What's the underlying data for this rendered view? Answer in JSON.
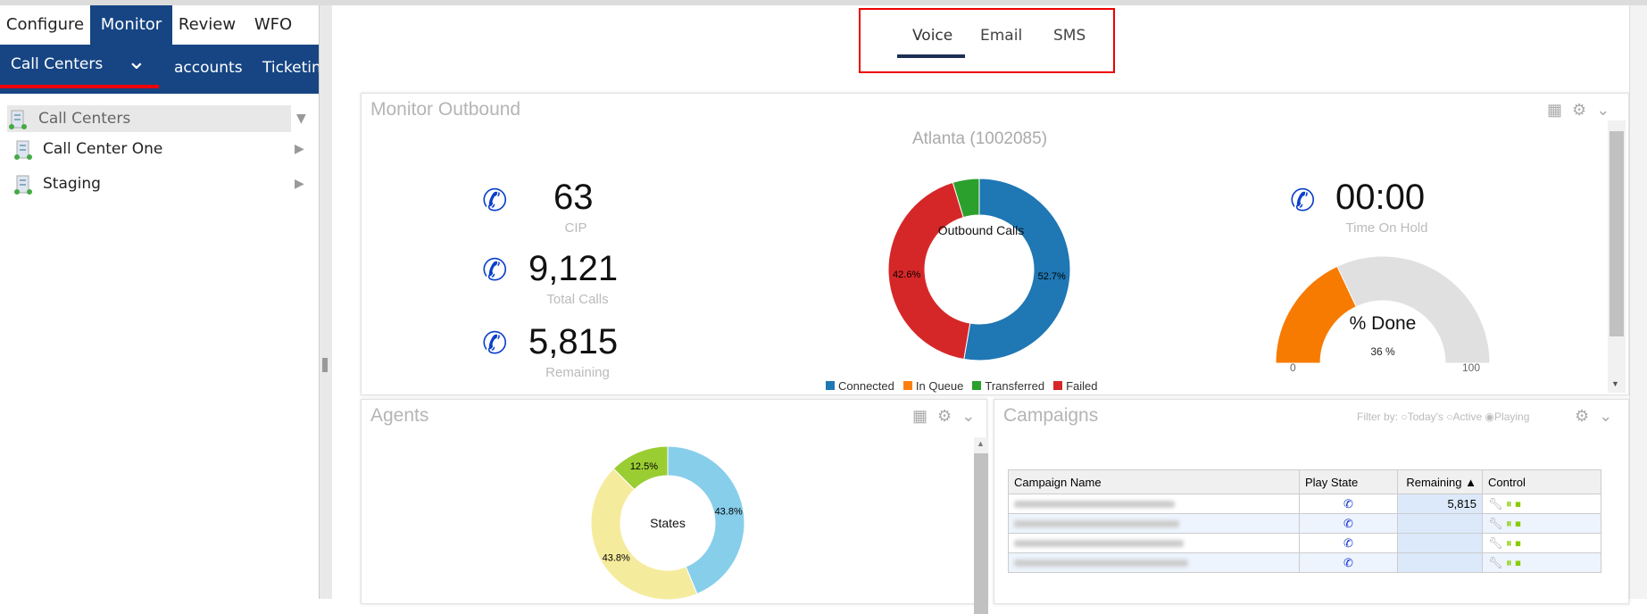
{
  "top_tabs": [
    {
      "label": "Configure"
    },
    {
      "label": "Monitor",
      "active": true
    },
    {
      "label": "Review"
    },
    {
      "label": "WFO"
    }
  ],
  "subnav": {
    "items": [
      {
        "label": "Call Centers",
        "active": true
      },
      {
        "label": "accounts"
      },
      {
        "label": "Ticketing"
      }
    ]
  },
  "tree": {
    "root": "Call Centers",
    "items": [
      {
        "label": "Call Center One"
      },
      {
        "label": "Staging"
      }
    ]
  },
  "channel_tabs": [
    {
      "label": "Voice",
      "active": true
    },
    {
      "label": "Email"
    },
    {
      "label": "SMS"
    }
  ],
  "monitor_outbound": {
    "title": "Monitor Outbound",
    "subtitle": "Atlanta (1002085)",
    "stats": [
      {
        "value": "63",
        "label": "CIP",
        "icon": "phone-ringing-icon"
      },
      {
        "value": "9,121",
        "label": "Total Calls",
        "icon": "phone-arrow-icon"
      },
      {
        "value": "5,815",
        "label": "Remaining",
        "icon": "phone-hourglass-icon"
      }
    ],
    "hold": {
      "value": "00:00",
      "label": "Time On Hold",
      "icon": "phone-clock-icon"
    },
    "gauge": {
      "title": "% Done",
      "value": 36,
      "value_label": "36 %",
      "min_label": "0",
      "max_label": "100",
      "fill_color": "#f77b00",
      "track_color": "#e0e0e0"
    }
  },
  "chart_data": [
    {
      "type": "pie",
      "title": "Outbound Calls",
      "categories": [
        "Connected",
        "In Queue",
        "Transferred",
        "Failed"
      ],
      "values": [
        52.7,
        0,
        4.7,
        42.6
      ],
      "data_labels": [
        "52.7%",
        "",
        "",
        "42.6%"
      ],
      "colors": [
        "#1f77b4",
        "#ff7f0e",
        "#2ca02c",
        "#d62728"
      ],
      "legend": "bottom"
    },
    {
      "type": "pie",
      "title": "States",
      "values": [
        43.8,
        43.8,
        12.5
      ],
      "data_labels": [
        "43.8%",
        "43.8%",
        "12.5%"
      ],
      "colors": [
        "#87ceeb",
        "#f5eb9c",
        "#9acd32"
      ]
    }
  ],
  "agents": {
    "title": "Agents"
  },
  "campaigns": {
    "title": "Campaigns",
    "filter_label": "Filter by:",
    "filters": [
      {
        "label": "Today's",
        "checked": false
      },
      {
        "label": "Active",
        "checked": false
      },
      {
        "label": "Playing",
        "checked": true
      }
    ],
    "columns": [
      "Campaign Name",
      "Play State",
      "Remaining",
      "Control"
    ],
    "rows": [
      {
        "remaining": "5,815"
      },
      {
        "remaining": ""
      },
      {
        "remaining": ""
      },
      {
        "remaining": ""
      }
    ]
  }
}
